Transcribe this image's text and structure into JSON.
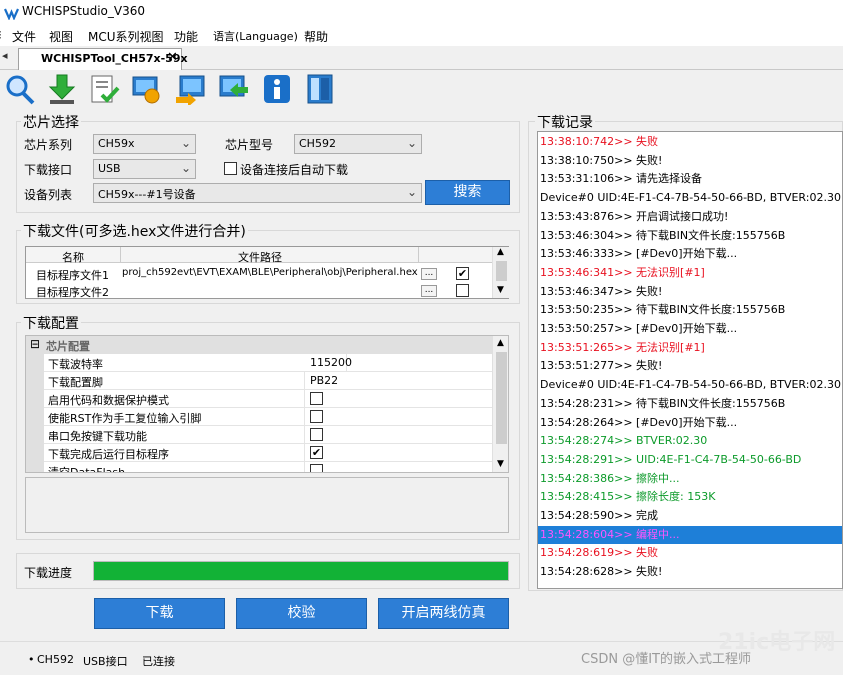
{
  "window": {
    "title": "WCHISPStudio_V360"
  },
  "menu": {
    "items": [
      "文件",
      "视图",
      "MCU系列视图",
      "功能",
      "语言(Language)",
      "帮助"
    ]
  },
  "tabs": {
    "left_marker": "◂",
    "active": "WCHISPTool_CH57x-59x",
    "close": "✕"
  },
  "toolbar": {
    "buttons": [
      "search-chip",
      "download",
      "verify",
      "refresh",
      "export",
      "import",
      "info",
      "layout"
    ]
  },
  "chip_select": {
    "title": "芯片选择",
    "series_label": "芯片系列",
    "series_value": "CH59x",
    "model_label": "芯片型号",
    "model_value": "CH592",
    "port_label": "下载接口",
    "port_value": "USB",
    "auto_label": "设备连接后自动下载",
    "devlist_label": "设备列表",
    "devlist_value": "CH59x---#1号设备",
    "search_button": "搜索"
  },
  "download_files": {
    "title": "下载文件(可多选.hex文件进行合并)",
    "col_name": "名称",
    "col_path": "文件路径",
    "rows": [
      {
        "name": "目标程序文件1",
        "path": "proj_ch592evt\\EVT\\EXAM\\BLE\\Peripheral\\obj\\Peripheral.hex",
        "browse": "...",
        "checked": true
      },
      {
        "name": "目标程序文件2",
        "path": "",
        "browse": "...",
        "checked": false
      }
    ]
  },
  "download_config": {
    "title": "下载配置",
    "category": "芯片配置",
    "collapse": "⊟",
    "rows": [
      {
        "name": "下载波特率",
        "value": "115200"
      },
      {
        "name": "下载配置脚",
        "value": "PB22"
      },
      {
        "name": "启用代码和数据保护模式",
        "checked": false
      },
      {
        "name": "使能RST作为手工复位输入引脚",
        "checked": false
      },
      {
        "name": "串口免按键下载功能",
        "checked": false
      },
      {
        "name": "下载完成后运行目标程序",
        "checked": true
      },
      {
        "name": "清空DataFlash",
        "checked": false
      }
    ]
  },
  "progress": {
    "label": "下载进度",
    "fraction": 1.0,
    "color": "#12b236"
  },
  "actions": {
    "download": "下载",
    "verify": "校验",
    "two_wire_sim": "开启两线仿真"
  },
  "log": {
    "title": "下载记录",
    "lines": [
      {
        "text": "13:38:10:742>> 失败",
        "color": "#e8101f",
        "bg": ""
      },
      {
        "text": "13:38:10:750>> 失败!",
        "color": "#000000",
        "bg": ""
      },
      {
        "text": "13:53:31:106>> 请先选择设备",
        "color": "#000000",
        "bg": ""
      },
      {
        "text": "Device#0  UID:4E-F1-C4-7B-54-50-66-BD, BTVER:02.30",
        "color": "#000000",
        "bg": ""
      },
      {
        "text": "13:53:43:876>> 开启调试接口成功!",
        "color": "#000000",
        "bg": ""
      },
      {
        "text": "13:53:46:304>> 待下载BIN文件长度:155756B",
        "color": "#000000",
        "bg": ""
      },
      {
        "text": "13:53:46:333>> [#Dev0]开始下载...",
        "color": "#000000",
        "bg": ""
      },
      {
        "text": "13:53:46:341>> 无法识别[#1]",
        "color": "#e8101f",
        "bg": ""
      },
      {
        "text": "13:53:46:347>> 失败!",
        "color": "#000000",
        "bg": ""
      },
      {
        "text": "13:53:50:235>> 待下载BIN文件长度:155756B",
        "color": "#000000",
        "bg": ""
      },
      {
        "text": "13:53:50:257>> [#Dev0]开始下载...",
        "color": "#000000",
        "bg": ""
      },
      {
        "text": "13:53:51:265>> 无法识别[#1]",
        "color": "#e8101f",
        "bg": ""
      },
      {
        "text": "13:53:51:277>> 失败!",
        "color": "#000000",
        "bg": ""
      },
      {
        "text": "Device#0  UID:4E-F1-C4-7B-54-50-66-BD, BTVER:02.30",
        "color": "#000000",
        "bg": ""
      },
      {
        "text": "13:54:28:231>> 待下载BIN文件长度:155756B",
        "color": "#000000",
        "bg": ""
      },
      {
        "text": "13:54:28:264>> [#Dev0]开始下载...",
        "color": "#000000",
        "bg": ""
      },
      {
        "text": "13:54:28:274>> BTVER:02.30",
        "color": "#0c9a2a",
        "bg": ""
      },
      {
        "text": "13:54:28:291>> UID:4E-F1-C4-7B-54-50-66-BD",
        "color": "#0c9a2a",
        "bg": ""
      },
      {
        "text": "13:54:28:386>> 擦除中...",
        "color": "#0c9a2a",
        "bg": ""
      },
      {
        "text": "13:54:28:415>> 擦除长度: 153K",
        "color": "#0c9a2a",
        "bg": ""
      },
      {
        "text": "13:54:28:590>> 完成",
        "color": "#000000",
        "bg": ""
      },
      {
        "text": "13:54:28:604>> 编程中...",
        "color": "#ff55ff",
        "bg": "#1e7fd8"
      },
      {
        "text": "13:54:28:619>> 失败",
        "color": "#e8101f",
        "bg": ""
      },
      {
        "text": "13:54:28:628>> 失败!",
        "color": "#000000",
        "bg": ""
      }
    ]
  },
  "status": {
    "bullet": "•",
    "chip": "CH592",
    "port": "USB接口",
    "state": "已连接"
  },
  "watermark": {
    "text": "CSDN @懂IT的嵌入式工程师",
    "logo_text": "21ic电子网"
  }
}
